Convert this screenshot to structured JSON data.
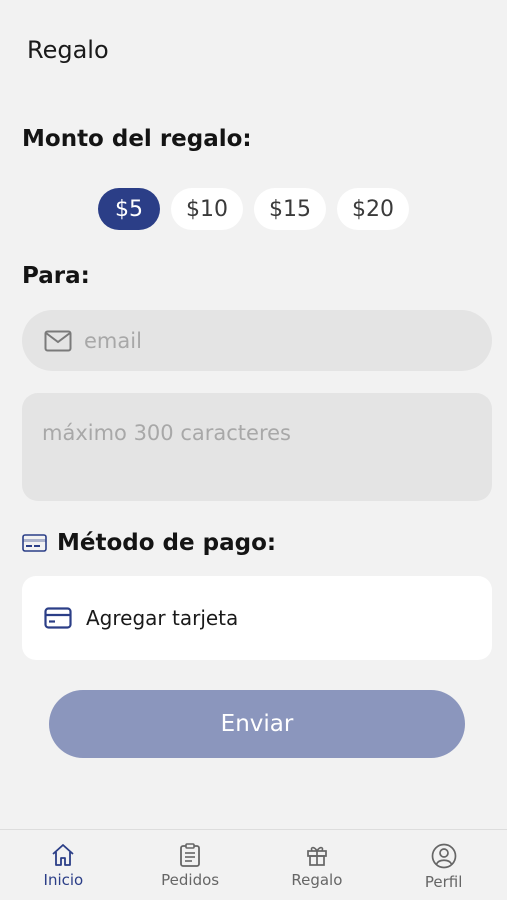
{
  "header": {
    "title": "Regalo"
  },
  "amount": {
    "label": "Monto del regalo:",
    "options": [
      "$5",
      "$10",
      "$15",
      "$20"
    ],
    "selected": "$5"
  },
  "recipient": {
    "label": "Para:",
    "email_placeholder": "email",
    "message_placeholder": "máximo 300 caracteres"
  },
  "payment": {
    "label": "Método de pago:",
    "add_card_label": "Agregar tarjeta"
  },
  "send_button": {
    "label": "Enviar"
  },
  "bottom_nav": {
    "items": [
      {
        "label": "Inicio",
        "icon": "home-icon",
        "active": true
      },
      {
        "label": "Pedidos",
        "icon": "clipboard-icon",
        "active": false
      },
      {
        "label": "Regalo",
        "icon": "gift-icon",
        "active": false
      },
      {
        "label": "Perfil",
        "icon": "user-icon",
        "active": false
      }
    ]
  },
  "colors": {
    "accent": "#2b3e87",
    "button_disabled": "#8b96bd",
    "background": "#f2f2f2"
  }
}
